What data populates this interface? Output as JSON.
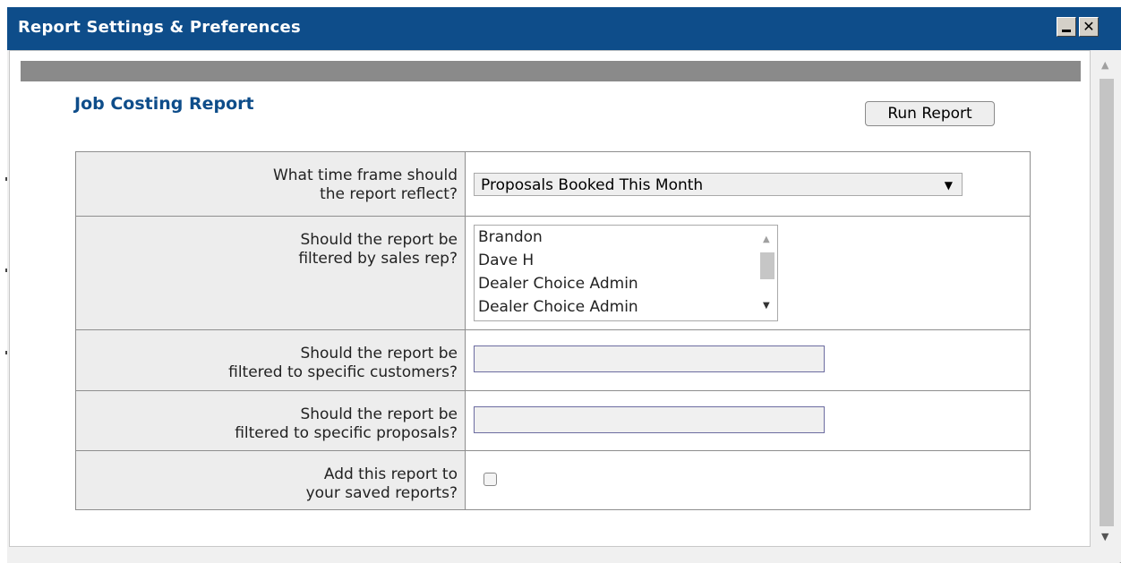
{
  "window": {
    "title": "Report Settings & Preferences",
    "minimize_label": "_",
    "close_label": "✕"
  },
  "report": {
    "title": "Job Costing Report",
    "run_button": "Run Report"
  },
  "form": {
    "time_frame": {
      "label_line1": "What time frame should",
      "label_line2": "the report reflect?",
      "selected": "Proposals Booked This Month"
    },
    "sales_rep": {
      "label_line1": "Should the report be",
      "label_line2": "filtered by sales rep?",
      "options": [
        "Brandon",
        "Dave H",
        "Dealer Choice Admin",
        "Dealer Choice Admin"
      ]
    },
    "customers": {
      "label_line1": "Should the report be",
      "label_line2": "filtered to specific customers?",
      "value": ""
    },
    "proposals": {
      "label_line1": "Should the report be",
      "label_line2": "filtered to specific proposals?",
      "value": ""
    },
    "saved": {
      "label_line1": "Add this report to",
      "label_line2": "your saved reports?",
      "checked": false
    }
  },
  "icons": {
    "dropdown_arrow": "dropdown-arrow-icon",
    "scroll_up": "scroll-up-icon",
    "scroll_down": "scroll-down-icon",
    "resize": "resize-grip-icon"
  },
  "colors": {
    "titlebar": "#0e4d8a",
    "report_title": "#0e4d8a",
    "header_bar": "#8a8a8a"
  }
}
